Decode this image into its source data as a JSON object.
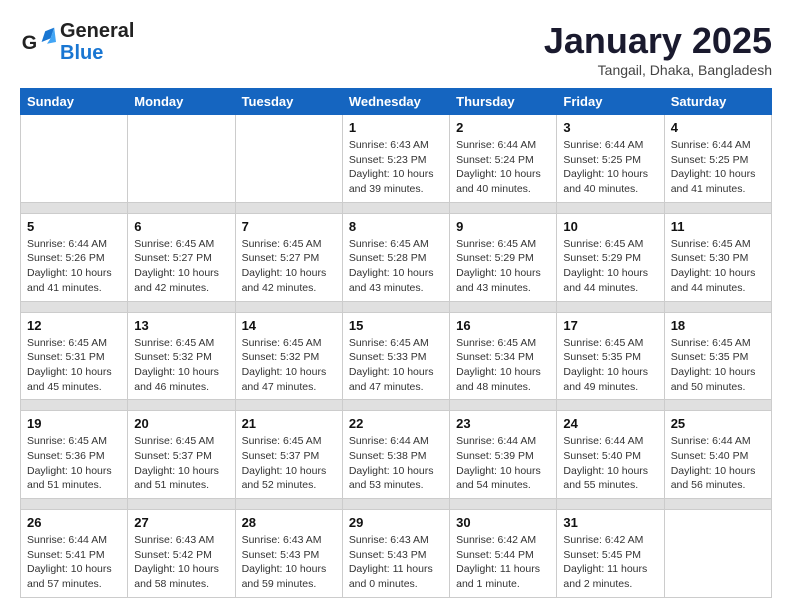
{
  "header": {
    "logo_general": "General",
    "logo_blue": "Blue",
    "title": "January 2025",
    "subtitle": "Tangail, Dhaka, Bangladesh"
  },
  "weekdays": [
    "Sunday",
    "Monday",
    "Tuesday",
    "Wednesday",
    "Thursday",
    "Friday",
    "Saturday"
  ],
  "weeks": [
    {
      "days": [
        {
          "num": "",
          "info": ""
        },
        {
          "num": "",
          "info": ""
        },
        {
          "num": "",
          "info": ""
        },
        {
          "num": "1",
          "info": "Sunrise: 6:43 AM\nSunset: 5:23 PM\nDaylight: 10 hours\nand 39 minutes."
        },
        {
          "num": "2",
          "info": "Sunrise: 6:44 AM\nSunset: 5:24 PM\nDaylight: 10 hours\nand 40 minutes."
        },
        {
          "num": "3",
          "info": "Sunrise: 6:44 AM\nSunset: 5:25 PM\nDaylight: 10 hours\nand 40 minutes."
        },
        {
          "num": "4",
          "info": "Sunrise: 6:44 AM\nSunset: 5:25 PM\nDaylight: 10 hours\nand 41 minutes."
        }
      ]
    },
    {
      "days": [
        {
          "num": "5",
          "info": "Sunrise: 6:44 AM\nSunset: 5:26 PM\nDaylight: 10 hours\nand 41 minutes."
        },
        {
          "num": "6",
          "info": "Sunrise: 6:45 AM\nSunset: 5:27 PM\nDaylight: 10 hours\nand 42 minutes."
        },
        {
          "num": "7",
          "info": "Sunrise: 6:45 AM\nSunset: 5:27 PM\nDaylight: 10 hours\nand 42 minutes."
        },
        {
          "num": "8",
          "info": "Sunrise: 6:45 AM\nSunset: 5:28 PM\nDaylight: 10 hours\nand 43 minutes."
        },
        {
          "num": "9",
          "info": "Sunrise: 6:45 AM\nSunset: 5:29 PM\nDaylight: 10 hours\nand 43 minutes."
        },
        {
          "num": "10",
          "info": "Sunrise: 6:45 AM\nSunset: 5:29 PM\nDaylight: 10 hours\nand 44 minutes."
        },
        {
          "num": "11",
          "info": "Sunrise: 6:45 AM\nSunset: 5:30 PM\nDaylight: 10 hours\nand 44 minutes."
        }
      ]
    },
    {
      "days": [
        {
          "num": "12",
          "info": "Sunrise: 6:45 AM\nSunset: 5:31 PM\nDaylight: 10 hours\nand 45 minutes."
        },
        {
          "num": "13",
          "info": "Sunrise: 6:45 AM\nSunset: 5:32 PM\nDaylight: 10 hours\nand 46 minutes."
        },
        {
          "num": "14",
          "info": "Sunrise: 6:45 AM\nSunset: 5:32 PM\nDaylight: 10 hours\nand 47 minutes."
        },
        {
          "num": "15",
          "info": "Sunrise: 6:45 AM\nSunset: 5:33 PM\nDaylight: 10 hours\nand 47 minutes."
        },
        {
          "num": "16",
          "info": "Sunrise: 6:45 AM\nSunset: 5:34 PM\nDaylight: 10 hours\nand 48 minutes."
        },
        {
          "num": "17",
          "info": "Sunrise: 6:45 AM\nSunset: 5:35 PM\nDaylight: 10 hours\nand 49 minutes."
        },
        {
          "num": "18",
          "info": "Sunrise: 6:45 AM\nSunset: 5:35 PM\nDaylight: 10 hours\nand 50 minutes."
        }
      ]
    },
    {
      "days": [
        {
          "num": "19",
          "info": "Sunrise: 6:45 AM\nSunset: 5:36 PM\nDaylight: 10 hours\nand 51 minutes."
        },
        {
          "num": "20",
          "info": "Sunrise: 6:45 AM\nSunset: 5:37 PM\nDaylight: 10 hours\nand 51 minutes."
        },
        {
          "num": "21",
          "info": "Sunrise: 6:45 AM\nSunset: 5:37 PM\nDaylight: 10 hours\nand 52 minutes."
        },
        {
          "num": "22",
          "info": "Sunrise: 6:44 AM\nSunset: 5:38 PM\nDaylight: 10 hours\nand 53 minutes."
        },
        {
          "num": "23",
          "info": "Sunrise: 6:44 AM\nSunset: 5:39 PM\nDaylight: 10 hours\nand 54 minutes."
        },
        {
          "num": "24",
          "info": "Sunrise: 6:44 AM\nSunset: 5:40 PM\nDaylight: 10 hours\nand 55 minutes."
        },
        {
          "num": "25",
          "info": "Sunrise: 6:44 AM\nSunset: 5:40 PM\nDaylight: 10 hours\nand 56 minutes."
        }
      ]
    },
    {
      "days": [
        {
          "num": "26",
          "info": "Sunrise: 6:44 AM\nSunset: 5:41 PM\nDaylight: 10 hours\nand 57 minutes."
        },
        {
          "num": "27",
          "info": "Sunrise: 6:43 AM\nSunset: 5:42 PM\nDaylight: 10 hours\nand 58 minutes."
        },
        {
          "num": "28",
          "info": "Sunrise: 6:43 AM\nSunset: 5:43 PM\nDaylight: 10 hours\nand 59 minutes."
        },
        {
          "num": "29",
          "info": "Sunrise: 6:43 AM\nSunset: 5:43 PM\nDaylight: 11 hours\nand 0 minutes."
        },
        {
          "num": "30",
          "info": "Sunrise: 6:42 AM\nSunset: 5:44 PM\nDaylight: 11 hours\nand 1 minute."
        },
        {
          "num": "31",
          "info": "Sunrise: 6:42 AM\nSunset: 5:45 PM\nDaylight: 11 hours\nand 2 minutes."
        },
        {
          "num": "",
          "info": ""
        }
      ]
    }
  ]
}
